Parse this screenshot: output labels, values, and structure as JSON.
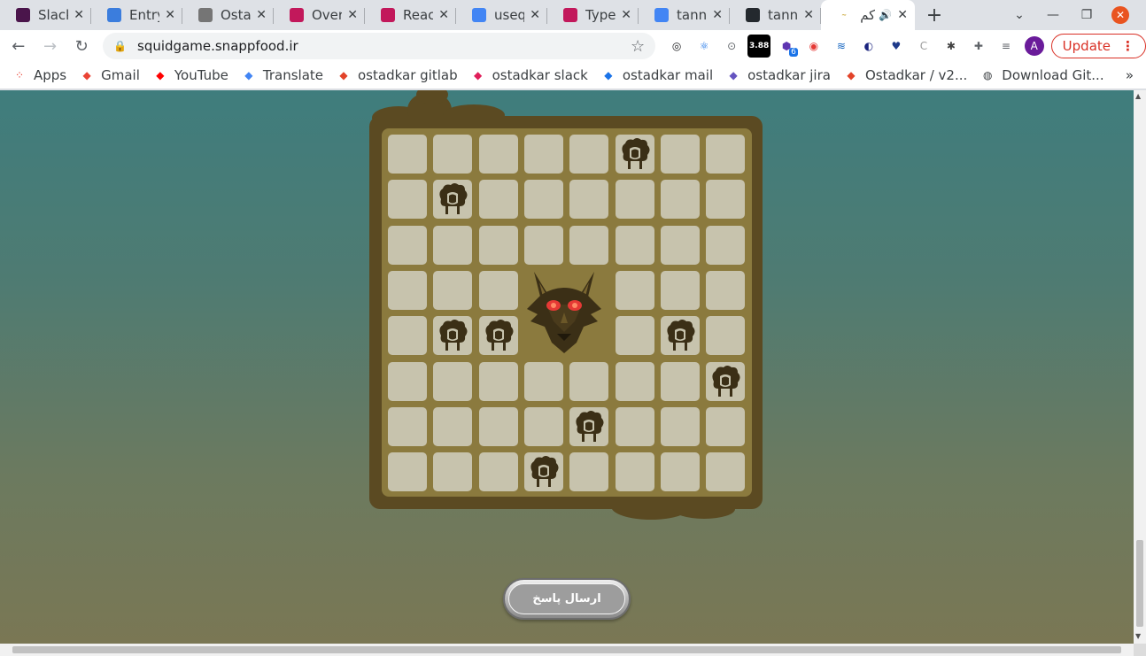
{
  "browser": {
    "tabs": [
      {
        "title": "Slack |",
        "icon": "slack-icon",
        "color": "#4a154b"
      },
      {
        "title": "Entry",
        "icon": "hexagon-icon",
        "color": "#3b7ddd"
      },
      {
        "title": "Ostad",
        "icon": "globe-icon",
        "color": "#757575"
      },
      {
        "title": "Overv",
        "icon": "gear-icon",
        "color": "#c2185b"
      },
      {
        "title": "React",
        "icon": "gear-icon",
        "color": "#c2185b"
      },
      {
        "title": "usequ",
        "icon": "google-icon",
        "color": "#4285f4"
      },
      {
        "title": "TypeS",
        "icon": "gear-icon",
        "color": "#c2185b"
      },
      {
        "title": "tanne",
        "icon": "google-icon",
        "color": "#4285f4"
      },
      {
        "title": "tanne",
        "icon": "github-icon",
        "color": "#24292e"
      }
    ],
    "active_tab": {
      "title": "کم",
      "icon": "snappfood-icon",
      "audio_icon": "speaker-icon"
    },
    "new_tab_label": "+",
    "url": "squidgame.snappfood.ir",
    "extensions": [
      {
        "name": "ext-1-icon",
        "glyph": "◎",
        "color": "#202124"
      },
      {
        "name": "react-icon",
        "glyph": "⚛",
        "color": "#1a73e8"
      },
      {
        "name": "ext-3-icon",
        "glyph": "⊙",
        "color": "#5f6368"
      },
      {
        "name": "lcp-icon",
        "glyph": "3.88",
        "color": "#000000"
      },
      {
        "name": "ext-5-icon",
        "glyph": "⬢",
        "color": "#5e35b1"
      },
      {
        "name": "ext-6-icon",
        "glyph": "◉",
        "color": "#e53935"
      },
      {
        "name": "ext-7-icon",
        "glyph": "≋",
        "color": "#1565c0"
      },
      {
        "name": "ext-8-icon",
        "glyph": "◐",
        "color": "#1a237e"
      },
      {
        "name": "ext-9-icon",
        "glyph": "♥",
        "color": "#1e3a8a"
      },
      {
        "name": "ext-10-icon",
        "glyph": "C",
        "color": "#9e9e9e"
      },
      {
        "name": "ext-11-icon",
        "glyph": "✱",
        "color": "#424242"
      },
      {
        "name": "puzzle-icon",
        "glyph": "✚",
        "color": "#5f6368"
      },
      {
        "name": "media-icon",
        "glyph": "≡",
        "color": "#5f6368"
      }
    ],
    "ext_badge": "6",
    "avatar_letter": "A",
    "update_label": "Update",
    "bookmarks": [
      {
        "label": "Apps",
        "icon": "apps-grid-icon",
        "color": "#ea4335"
      },
      {
        "label": "Gmail",
        "icon": "gmail-icon",
        "color": "#ea4335"
      },
      {
        "label": "YouTube",
        "icon": "youtube-icon",
        "color": "#ff0000"
      },
      {
        "label": "Translate",
        "icon": "translate-icon",
        "color": "#4285f4"
      },
      {
        "label": "ostadkar gitlab",
        "icon": "gitlab-icon",
        "color": "#e24329"
      },
      {
        "label": "ostadkar slack",
        "icon": "slack-icon",
        "color": "#e01e5a"
      },
      {
        "label": "ostadkar mail",
        "icon": "mail-icon",
        "color": "#1a73e8"
      },
      {
        "label": "ostadkar jira",
        "icon": "jira-icon",
        "color": "#6554c0"
      },
      {
        "label": "Ostadkar / v2...",
        "icon": "gitlab-icon",
        "color": "#e24329"
      },
      {
        "label": "Download Git...",
        "icon": "globe-icon",
        "color": "#3c4043"
      }
    ],
    "bookmarks_more": "»"
  },
  "game": {
    "grid_size": 8,
    "wolf_cell": {
      "row": 3,
      "col": 3,
      "span": 2
    },
    "sheep": [
      {
        "row": 0,
        "col": 5
      },
      {
        "row": 1,
        "col": 1
      },
      {
        "row": 4,
        "col": 1
      },
      {
        "row": 4,
        "col": 2
      },
      {
        "row": 4,
        "col": 6
      },
      {
        "row": 5,
        "col": 7
      },
      {
        "row": 6,
        "col": 4
      },
      {
        "row": 7,
        "col": 3
      }
    ],
    "submit_label": "ارسال پاسخ",
    "colors": {
      "frame": "#5b4a22",
      "board": "#8b7a3e",
      "cell": "#c7c3ad",
      "sheep": "#3b2f16",
      "wolf_eyes": "#e53935"
    }
  }
}
